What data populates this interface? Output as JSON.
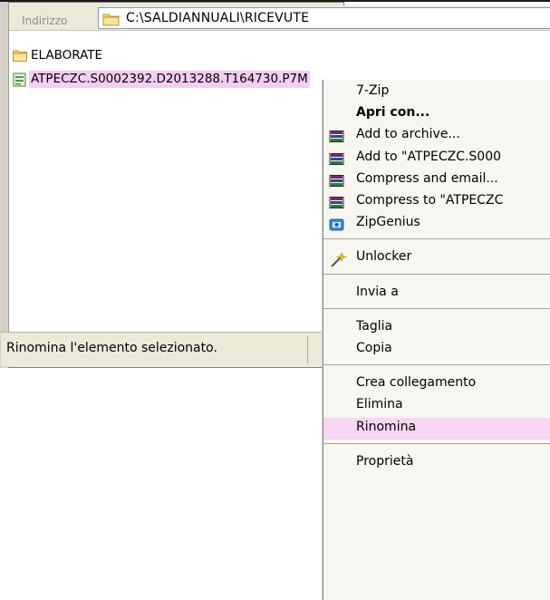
{
  "address": {
    "label": "Indirizzo",
    "path": "C:\\SALDIANNUALI\\RICEVUTE"
  },
  "files": [
    {
      "name": "ELABORATE",
      "type": "folder"
    },
    {
      "name": "ATPECZC.S0002392.D2013288.T164730.P7M",
      "type": "file"
    }
  ],
  "status": {
    "text": "Rinomina l'elemento selezionato."
  },
  "context_menu": {
    "groups": [
      [
        {
          "label": "7-Zip",
          "icon": "none"
        },
        {
          "label": "Apri con...",
          "icon": "none",
          "bold": true
        },
        {
          "label": "Add to archive...",
          "icon": "winrar-icon"
        },
        {
          "label": "Add to \"ATPECZC.S000",
          "icon": "winrar-icon"
        },
        {
          "label": "Compress and email...",
          "icon": "winrar-icon"
        },
        {
          "label": "Compress to \"ATPECZC",
          "icon": "winrar-icon"
        },
        {
          "label": "ZipGenius",
          "icon": "zipgenius-icon"
        }
      ],
      [
        {
          "label": "Unlocker",
          "icon": "wand-icon"
        }
      ],
      [
        {
          "label": "Invia a",
          "icon": "none"
        }
      ],
      [
        {
          "label": "Taglia",
          "icon": "none"
        },
        {
          "label": "Copia",
          "icon": "none"
        }
      ],
      [
        {
          "label": "Crea collegamento",
          "icon": "none"
        },
        {
          "label": "Elimina",
          "icon": "none"
        },
        {
          "label": "Rinomina",
          "icon": "none",
          "highlighted": true
        }
      ],
      [
        {
          "label": "Proprietà",
          "icon": "none"
        }
      ]
    ]
  },
  "colors": {
    "selection": "#f3cdf2",
    "menu_highlight": "#f6d6f3",
    "menu_bg": "#f7f6f1"
  }
}
